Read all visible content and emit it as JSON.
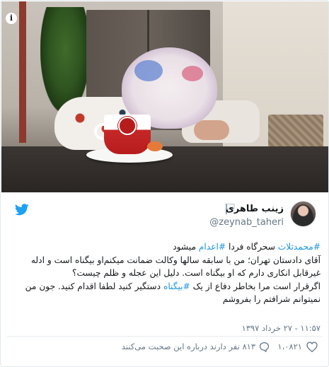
{
  "photo": {
    "alt_context": "photo",
    "info_glyph": "i"
  },
  "author": {
    "display_name": "زینب طاهری",
    "handle": "@zeynab_taheri",
    "flag_icon": "white-flag-icon",
    "avatar_icon": "avatar"
  },
  "platform": {
    "icon": "twitter-bird-icon",
    "brand_color": "#1da1f2"
  },
  "tweet": {
    "line1": {
      "hashtag_1": "#محمدثلاث",
      "text_1": " سحرگاه فردا ",
      "hashtag_2": "#اعدام",
      "text_2": " میشود"
    },
    "line2": "آقای دادستان تهران؛ من با سابقه سالها وکالت ضمانت میکنم‌او بیگناه است و ادله",
    "line3": "غیرقابل انکاری دارم که او بیگناه است. دلیل این عجله و ظلم چیست؟",
    "line4": {
      "text_1": "اگرقرار است مرا بخاطر دفاع از یک ",
      "hashtag": "#بیگناه",
      "text_2": " دستگیر کنید لطفا اقدام کنید. جون من"
    },
    "line5": "نمیتوانم شرافتم را بفروشم",
    "hashtag_color": "#1b95e0"
  },
  "timestamp": "۱۱:۵۷ - ۲۷ خرداد ۱۳۹۷",
  "footer": {
    "like_count": "۱،۰۸۲۱",
    "talk_text": "۸۱۳ نفر دارند درباره این صحبت می‌کنند",
    "like_icon": "heart-icon",
    "reply_icon": "reply-bubble-icon"
  }
}
